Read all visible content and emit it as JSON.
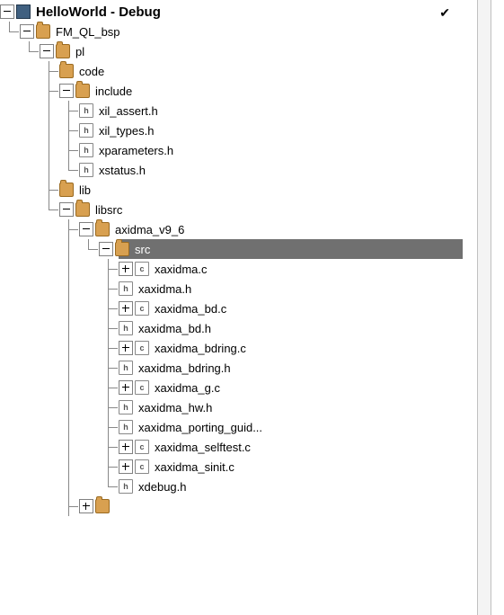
{
  "root": {
    "label": "HelloWorld - Debug"
  },
  "bsp": {
    "label": "FM_QL_bsp"
  },
  "pl": {
    "label": "pl"
  },
  "code": {
    "label": "code"
  },
  "include": {
    "label": "include"
  },
  "include_files": {
    "f0": "xil_assert.h",
    "f1": "xil_types.h",
    "f2": "xparameters.h",
    "f3": "xstatus.h"
  },
  "lib": {
    "label": "lib"
  },
  "libsrc": {
    "label": "libsrc"
  },
  "axidma": {
    "label": "axidma_v9_6"
  },
  "src": {
    "label": "src"
  },
  "src_files": {
    "f0": "xaxidma.c",
    "f1": "xaxidma.h",
    "f2": "xaxidma_bd.c",
    "f3": "xaxidma_bd.h",
    "f4": "xaxidma_bdring.c",
    "f5": "xaxidma_bdring.h",
    "f6": "xaxidma_g.c",
    "f7": "xaxidma_hw.h",
    "f8": "xaxidma_porting_guid...",
    "f9": "xaxidma_selftest.c",
    "f10": "xaxidma_sinit.c",
    "f11": "xdebug.h"
  }
}
